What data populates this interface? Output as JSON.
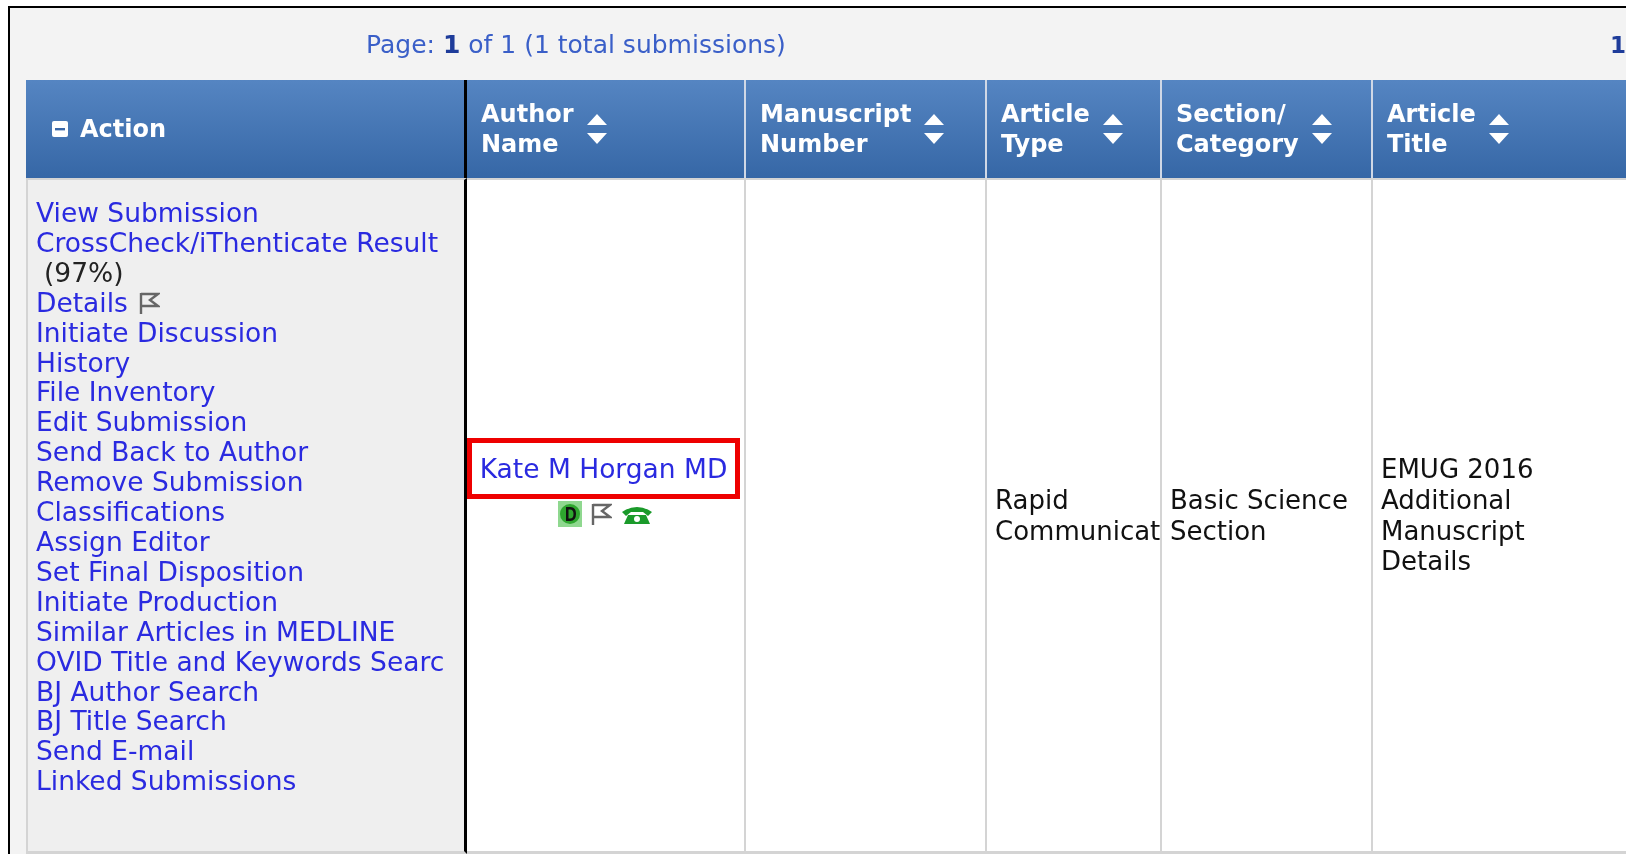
{
  "pager": {
    "label": "Page:",
    "current": "1",
    "rest": "of 1 (1 total submissions)",
    "corner": "1"
  },
  "table": {
    "columns": [
      {
        "label": "Action",
        "kind": "collapse"
      },
      {
        "label": "Author Name",
        "kind": "sortable"
      },
      {
        "label": "Manuscript Number",
        "kind": "sortable"
      },
      {
        "label": "Article Type",
        "kind": "sortable"
      },
      {
        "label": "Section/ Category",
        "kind": "sortable"
      },
      {
        "label": "Article Title",
        "kind": "sortable"
      }
    ],
    "rows": [
      {
        "actions": [
          {
            "label": "View Submission",
            "kind": "link"
          },
          {
            "label": "CrossCheck/iThenticate Result",
            "kind": "score",
            "note": "(97%)"
          },
          {
            "label": "Details",
            "kind": "flag"
          },
          {
            "label": "Initiate Discussion",
            "kind": "link"
          },
          {
            "label": "History",
            "kind": "link"
          },
          {
            "label": "File Inventory",
            "kind": "link"
          },
          {
            "label": "Edit Submission",
            "kind": "link"
          },
          {
            "label": "Send Back to Author",
            "kind": "link"
          },
          {
            "label": "Remove Submission",
            "kind": "link"
          },
          {
            "label": "Classifications",
            "kind": "link"
          },
          {
            "label": "Assign Editor",
            "kind": "link"
          },
          {
            "label": "Set Final Disposition",
            "kind": "link"
          },
          {
            "label": "Initiate Production",
            "kind": "link"
          },
          {
            "label": "Similar Articles in MEDLINE",
            "kind": "link"
          },
          {
            "label": "OVID Title and Keywords Searc",
            "kind": "link"
          },
          {
            "label": "BJ Author Search",
            "kind": "link"
          },
          {
            "label": "BJ Title Search",
            "kind": "link"
          },
          {
            "label": "Send E-mail",
            "kind": "link"
          },
          {
            "label": "Linked Submissions",
            "kind": "link"
          }
        ],
        "author": {
          "name": "Kate M Horgan MD",
          "highlighted": true
        },
        "article_type": "Rapid Communicat",
        "section": "Basic Science Section",
        "title": "EMUG 2016 Additional Manuscript Details"
      }
    ]
  }
}
